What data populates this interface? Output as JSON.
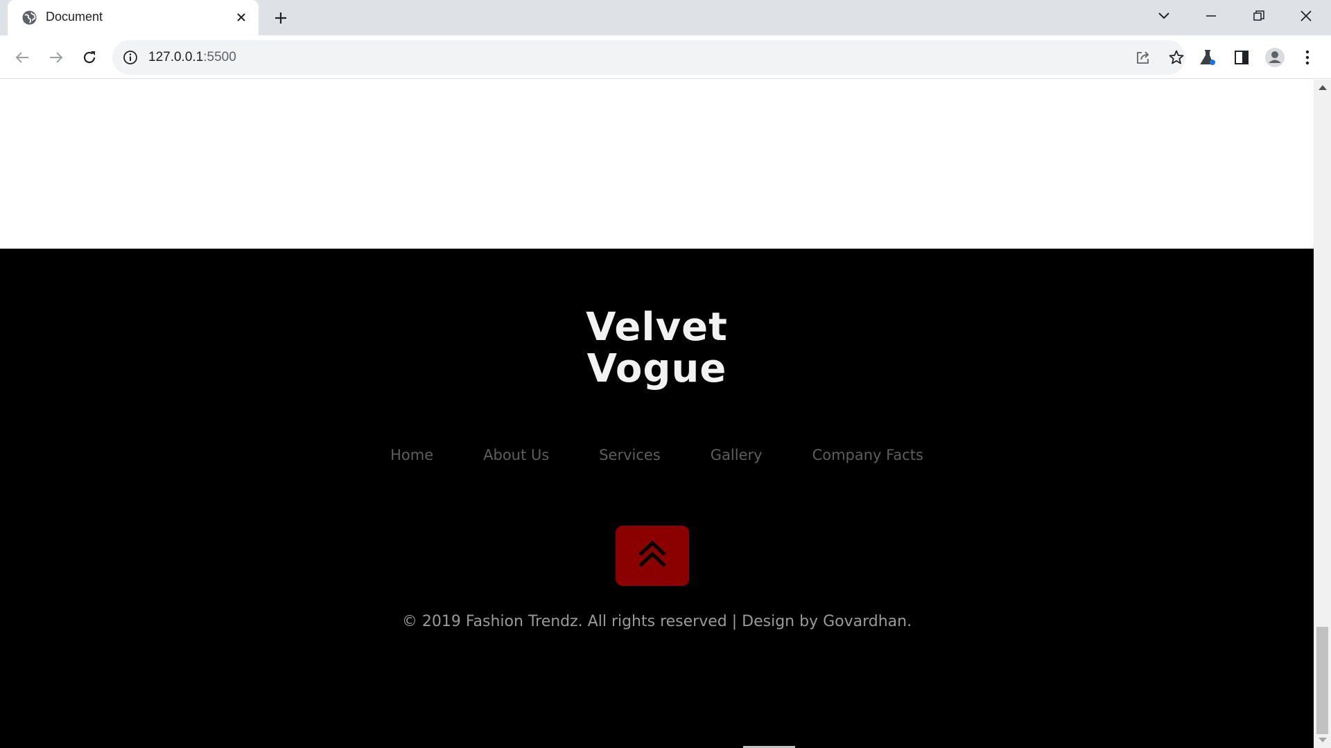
{
  "browser": {
    "tab_title": "Document",
    "url_host": "127.0.0.1",
    "url_port": ":5500"
  },
  "icons": {
    "favicon": "globe-icon",
    "tab_close": "close-icon",
    "new_tab": "plus-icon",
    "tab_search": "chevron-down-icon",
    "minimize": "minimize-icon",
    "restore": "restore-icon",
    "close_window": "close-icon",
    "back": "arrow-left-icon",
    "forward": "arrow-right-icon",
    "reload": "reload-icon",
    "site_info": "info-icon",
    "share": "share-icon",
    "bookmark": "star-icon",
    "labs": "flask-icon",
    "side_panel": "side-panel-icon",
    "profile": "avatar-icon",
    "menu": "kebab-menu-icon",
    "back_to_top": "double-chevron-up-icon"
  },
  "colors": {
    "footer_bg": "#000000",
    "brand_text": "#f2f2f2",
    "nav_link": "#5e5e5e",
    "back_to_top_bg": "#8b0000",
    "copyright_text": "#9a9a9a"
  },
  "footer": {
    "brand_line1": "Velvet",
    "brand_line2": "Vogue",
    "nav": [
      "Home",
      "About Us",
      "Services",
      "Gallery",
      "Company Facts"
    ],
    "copyright": "© 2019 Fashion Trendz. All rights reserved | Design by Govardhan."
  }
}
